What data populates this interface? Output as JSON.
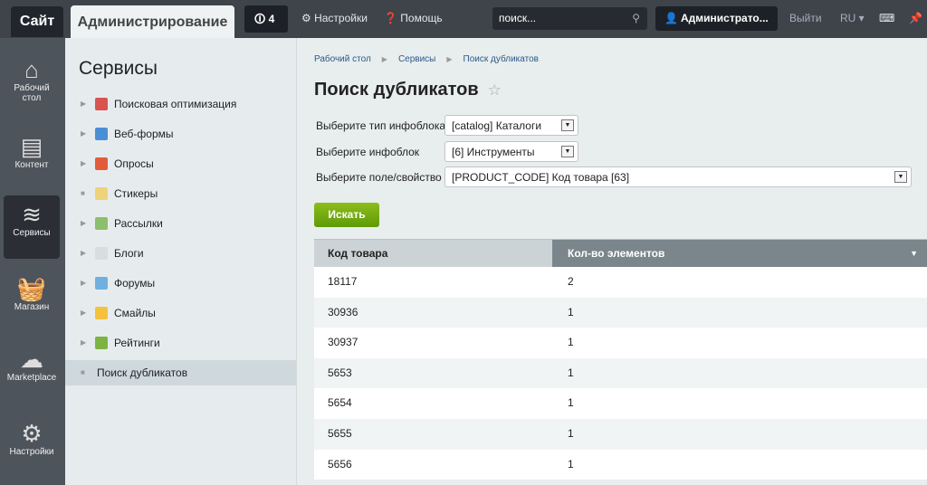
{
  "top": {
    "site": "Сайт",
    "admin": "Администрирование",
    "notifications": "4",
    "settings": "Настройки",
    "help": "Помощь",
    "search_placeholder": "поиск...",
    "user": "Администрато...",
    "logout": "Выйти",
    "lang": "RU"
  },
  "left_nav": [
    {
      "label": "Рабочий стол",
      "icon": "home-icon"
    },
    {
      "label": "Контент",
      "icon": "document-icon"
    },
    {
      "label": "Сервисы",
      "icon": "layers-icon",
      "active": true
    },
    {
      "label": "Магазин",
      "icon": "basket-icon"
    },
    {
      "label": "Marketplace",
      "icon": "cloud-download-icon"
    },
    {
      "label": "Настройки",
      "icon": "gear-icon"
    }
  ],
  "services": {
    "title": "Сервисы",
    "items": [
      {
        "label": "Поисковая оптимизация",
        "color": "#d9534f"
      },
      {
        "label": "Веб-формы",
        "color": "#4a8fd6"
      },
      {
        "label": "Опросы",
        "color": "#e25c3c"
      },
      {
        "label": "Стикеры",
        "color": "#f0d27a"
      },
      {
        "label": "Рассылки",
        "color": "#8cbf6a"
      },
      {
        "label": "Блоги",
        "color": "#d8dde0"
      },
      {
        "label": "Форумы",
        "color": "#6fb0e0"
      },
      {
        "label": "Смайлы",
        "color": "#f4c23c"
      },
      {
        "label": "Рейтинги",
        "color": "#7cb342"
      },
      {
        "label": "Поиск дубликатов",
        "selected": true
      }
    ]
  },
  "breadcrumb": [
    "Рабочий стол",
    "Сервисы",
    "Поиск дубликатов"
  ],
  "page": {
    "title": "Поиск дубликатов",
    "fields": [
      {
        "label": "Выберите тип инфоблока",
        "value": "[catalog] Каталоги"
      },
      {
        "label": "Выберите инфоблок",
        "value": "[6] Инструменты"
      },
      {
        "label": "Выберите поле/свойство",
        "value": "[PRODUCT_CODE] Код товара [63]"
      }
    ],
    "search_button": "Искать"
  },
  "table": {
    "headers": [
      "Код товара",
      "Кол-во элементов"
    ],
    "rows": [
      [
        "18117",
        "2"
      ],
      [
        "30936",
        "1"
      ],
      [
        "30937",
        "1"
      ],
      [
        "5653",
        "1"
      ],
      [
        "5654",
        "1"
      ],
      [
        "5655",
        "1"
      ],
      [
        "5656",
        "1"
      ]
    ]
  }
}
